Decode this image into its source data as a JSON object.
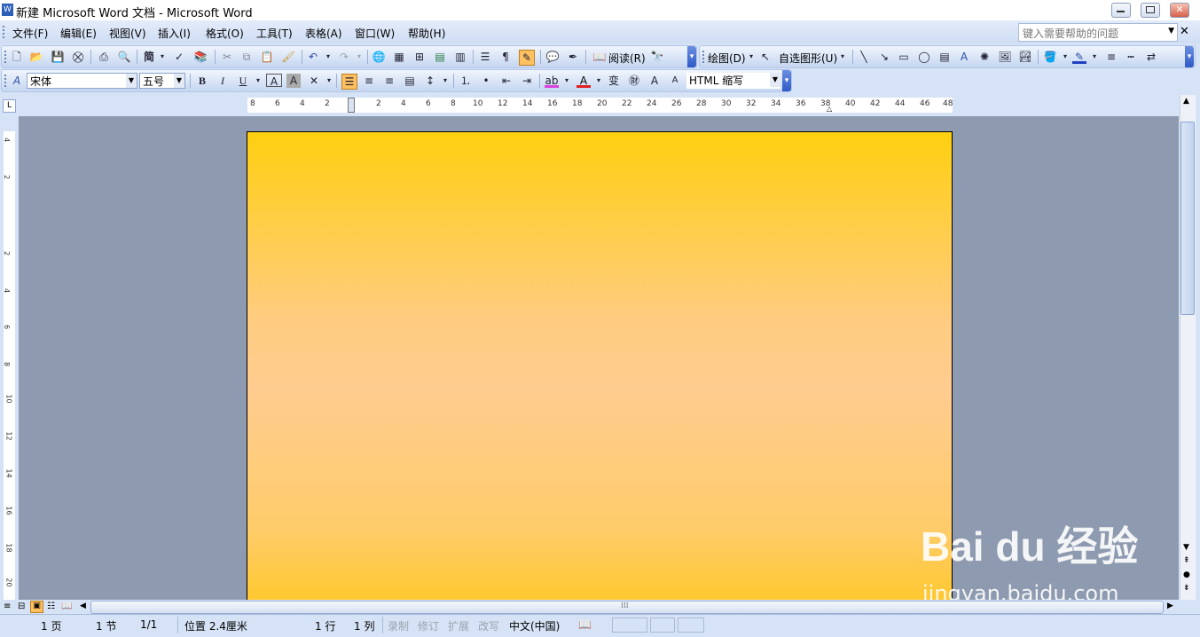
{
  "window": {
    "title": "新建 Microsoft Word 文档 - Microsoft Word"
  },
  "menu": {
    "items": [
      "文件(F)",
      "编辑(E)",
      "视图(V)",
      "插入(I)",
      "格式(O)",
      "工具(T)",
      "表格(A)",
      "窗口(W)",
      "帮助(H)"
    ],
    "help_placeholder": "键入需要帮助的问题"
  },
  "toolbar": {
    "read_label": "阅读(R)",
    "draw_label": "绘图(D)",
    "autoshape_label": "自选图形(U)",
    "font_name": "宋体",
    "font_size": "五号",
    "style_box": "HTML 缩写"
  },
  "ruler": {
    "h_numbers": [
      "8",
      "6",
      "4",
      "2",
      "2",
      "4",
      "6",
      "8",
      "10",
      "12",
      "14",
      "16",
      "18",
      "20",
      "22",
      "24",
      "26",
      "28",
      "30",
      "32",
      "34",
      "36",
      "38",
      "40",
      "42",
      "44",
      "46",
      "48"
    ],
    "v_numbers": [
      "4",
      "2",
      "2",
      "4",
      "6",
      "8",
      "10",
      "12",
      "14",
      "16",
      "18",
      "20"
    ]
  },
  "status": {
    "page": "1 页",
    "section": "1 节",
    "page_of": "1/1",
    "position": "位置 2.4厘米",
    "line": "1 行",
    "column": "1 列",
    "rec": "录制",
    "trk": "修订",
    "ext": "扩展",
    "ovr": "改写",
    "language": "中文(中国)"
  },
  "watermark": {
    "brand": "Bai du 经验",
    "url": "jingyan.baidu.com"
  },
  "colors": {
    "page_top": "#ffcf10",
    "page_mid": "#ffcc90",
    "workspace": "#8e9aaf",
    "chrome": "#d6e3f6"
  }
}
